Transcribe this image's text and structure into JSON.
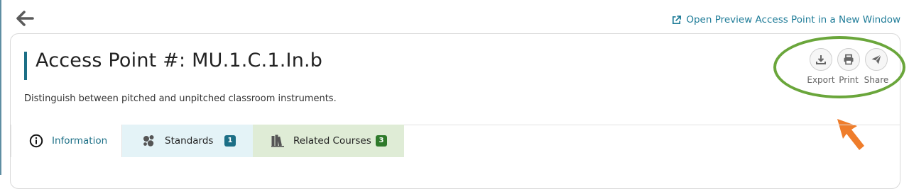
{
  "header": {
    "back_icon": "arrow-left-icon",
    "preview_link": {
      "label": "Open Preview Access Point in a New Window",
      "icon": "external-link-icon"
    }
  },
  "access_point": {
    "title": "Access Point #: MU.1.C.1.In.b",
    "description": "Distinguish between pitched and unpitched classroom instruments."
  },
  "actions": [
    {
      "label": "Export",
      "icon": "download-icon"
    },
    {
      "label": "Print",
      "icon": "printer-icon"
    },
    {
      "label": "Share",
      "icon": "paper-plane-icon"
    }
  ],
  "tabs": [
    {
      "label": "Information",
      "icon": "info-circle-icon",
      "badge": ""
    },
    {
      "label": "Standards",
      "icon": "standards-cluster-icon",
      "badge": "1"
    },
    {
      "label": "Related Courses",
      "icon": "books-icon",
      "badge": "3"
    }
  ],
  "colors": {
    "accent": "#1c6f86",
    "highlight_ellipse": "#6aa63b",
    "pointer_arrow": "#ef7d2b",
    "standards_tab_bg": "#e4f3f7",
    "courses_tab_bg": "#dfecd6"
  }
}
